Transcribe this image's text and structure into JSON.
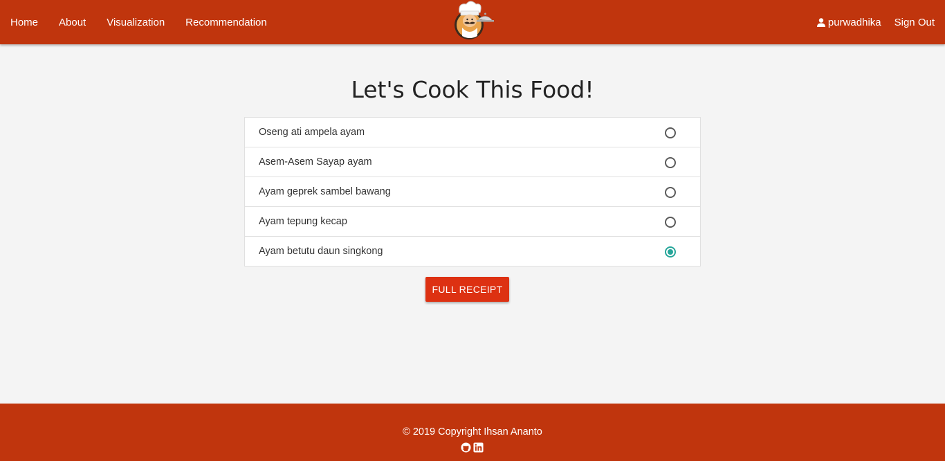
{
  "nav": {
    "home": "Home",
    "about": "About",
    "visualization": "Visualization",
    "recommendation": "Recommendation",
    "username": "purwadhika",
    "signout": "Sign Out"
  },
  "logo_icon": "chef-logo",
  "page": {
    "title": "Let's Cook This Food!"
  },
  "options": [
    {
      "label": "Oseng ati ampela ayam",
      "checked": false
    },
    {
      "label": "Asem-Asem Sayap ayam",
      "checked": false
    },
    {
      "label": "Ayam geprek sambel bawang",
      "checked": false
    },
    {
      "label": "Ayam tepung kecap",
      "checked": false
    },
    {
      "label": "Ayam betutu daun singkong",
      "checked": true
    }
  ],
  "button": {
    "label": "FULL RECEIPT"
  },
  "footer": {
    "copyright": "© 2019 Copyright Ihsan Ananto",
    "icons": [
      "github-icon",
      "linkedin-icon"
    ]
  },
  "colors": {
    "nav": "#c0350d",
    "button": "#dd3112",
    "radio_checked": "#26a69a",
    "background": "#f4f4f4"
  }
}
